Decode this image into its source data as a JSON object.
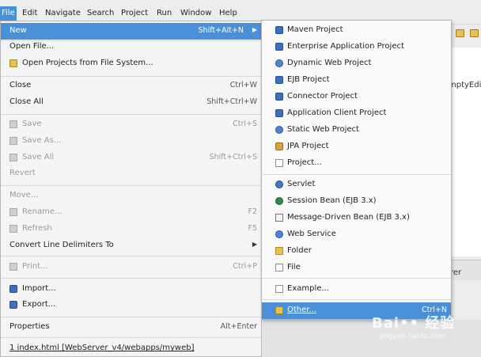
{
  "menubar": {
    "file": "File",
    "edit": "Edit",
    "navigate": "Navigate",
    "search": "Search",
    "project": "Project",
    "run": "Run",
    "window": "Window",
    "help": "Help"
  },
  "background": {
    "editor_tab_fragment": "mptyEdi",
    "view_tab_fragment": "rer"
  },
  "file_menu": {
    "new": {
      "label": "New",
      "shortcut": "Shift+Alt+N"
    },
    "open_file": {
      "label": "Open File..."
    },
    "open_projects": {
      "label": "Open Projects from File System..."
    },
    "close": {
      "label": "Close",
      "shortcut": "Ctrl+W"
    },
    "close_all": {
      "label": "Close All",
      "shortcut": "Shift+Ctrl+W"
    },
    "save": {
      "label": "Save",
      "shortcut": "Ctrl+S"
    },
    "save_as": {
      "label": "Save As..."
    },
    "save_all": {
      "label": "Save All",
      "shortcut": "Shift+Ctrl+S"
    },
    "revert": {
      "label": "Revert"
    },
    "move": {
      "label": "Move..."
    },
    "rename": {
      "label": "Rename...",
      "shortcut": "F2"
    },
    "refresh": {
      "label": "Refresh",
      "shortcut": "F5"
    },
    "convert": {
      "label": "Convert Line Delimiters To"
    },
    "print": {
      "label": "Print...",
      "shortcut": "Ctrl+P"
    },
    "import": {
      "label": "Import..."
    },
    "export": {
      "label": "Export..."
    },
    "properties": {
      "label": "Properties",
      "shortcut": "Alt+Enter"
    },
    "recent": {
      "label": "1 index.html  [WebServer_v4/webapps/myweb]"
    }
  },
  "new_submenu": {
    "maven": {
      "label": "Maven Project",
      "icon": "maven-project-icon"
    },
    "enterprise": {
      "label": "Enterprise Application Project",
      "icon": "ear-project-icon"
    },
    "dynamic_web": {
      "label": "Dynamic Web Project",
      "icon": "web-project-icon"
    },
    "ejb": {
      "label": "EJB Project",
      "icon": "ejb-project-icon"
    },
    "connector": {
      "label": "Connector Project",
      "icon": "connector-project-icon"
    },
    "app_client": {
      "label": "Application Client Project",
      "icon": "app-client-project-icon"
    },
    "static_web": {
      "label": "Static Web Project",
      "icon": "static-web-project-icon"
    },
    "jpa": {
      "label": "JPA Project",
      "icon": "jpa-project-icon"
    },
    "project": {
      "label": "Project...",
      "icon": "project-icon"
    },
    "servlet": {
      "label": "Servlet",
      "icon": "servlet-icon"
    },
    "session_bean": {
      "label": "Session Bean (EJB 3.x)",
      "icon": "session-bean-icon"
    },
    "mdb": {
      "label": "Message-Driven Bean (EJB 3.x)",
      "icon": "message-bean-icon"
    },
    "web_service": {
      "label": "Web Service",
      "icon": "web-service-icon"
    },
    "folder": {
      "label": "Folder",
      "icon": "folder-icon"
    },
    "file": {
      "label": "File",
      "icon": "file-icon"
    },
    "example": {
      "label": "Example...",
      "icon": "example-icon"
    },
    "other": {
      "label": "Other...",
      "shortcut": "Ctrl+N",
      "icon": "other-wizard-icon"
    }
  },
  "watermark": {
    "brand": "Bai•• 经验",
    "url": "jingyan.baidu.com"
  },
  "colors": {
    "highlight": "#4a90d9",
    "menu_bg": "#f5f5f5",
    "disabled_text": "#9a9a9a"
  }
}
